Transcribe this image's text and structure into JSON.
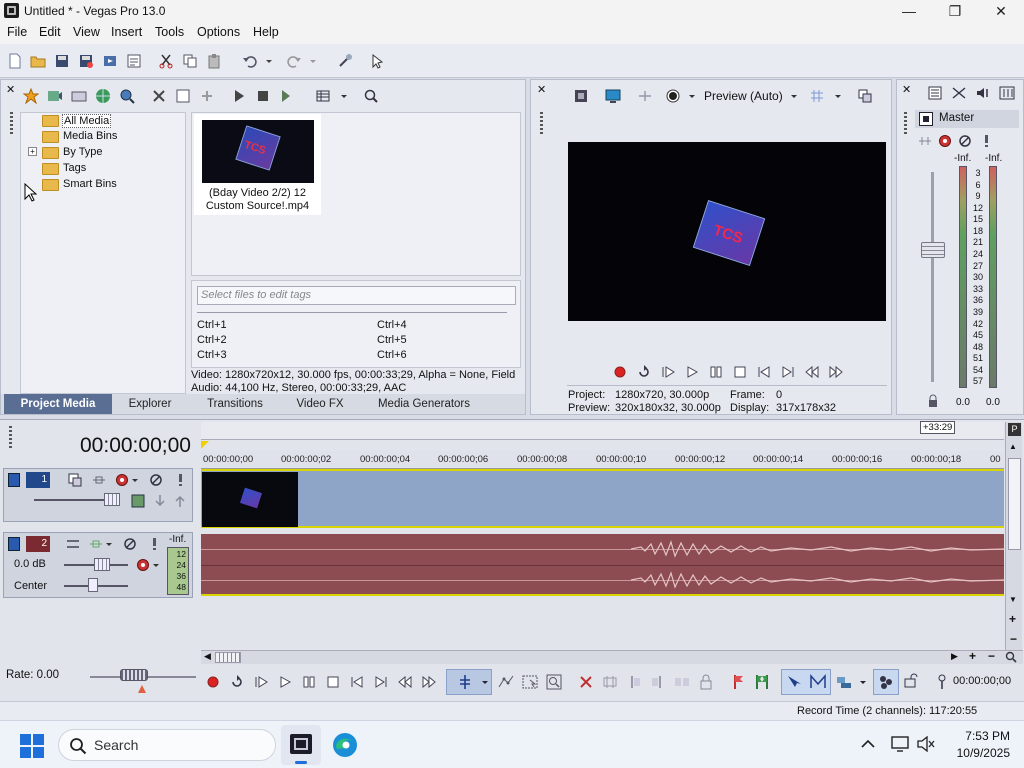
{
  "window": {
    "title": "Untitled * - Vegas Pro 13.0",
    "minimize": "—",
    "maximize": "❐",
    "close": "✕"
  },
  "menu": [
    "File",
    "Edit",
    "View",
    "Insert",
    "Tools",
    "Options",
    "Help"
  ],
  "explorer_tree": {
    "items": [
      {
        "label": "All Media",
        "selected": true
      },
      {
        "label": "Media Bins"
      },
      {
        "label": "By Type",
        "expander": "+"
      },
      {
        "label": "Tags"
      },
      {
        "label": "Smart Bins"
      }
    ]
  },
  "media": {
    "file_name": "(Bday Video 2/2) 12 Custom Source!.mp4",
    "file_name_line1": "(Bday Video 2/2) 12",
    "file_name_line2": "Custom Source!.mp4",
    "thumb_text": "TCS"
  },
  "tags": {
    "placeholder": "Select files to edit tags",
    "shortcuts": [
      "Ctrl+1",
      "Ctrl+4",
      "Ctrl+2",
      "Ctrl+5",
      "Ctrl+3",
      "Ctrl+6"
    ]
  },
  "media_info": {
    "video": "Video: 1280x720x12, 30.000 fps, 00:00:33;29, Alpha = None, Field",
    "audio": "Audio: 44,100 Hz, Stereo, 00:00:33;29, AAC"
  },
  "tabs": [
    "Project Media",
    "Explorer",
    "Transitions",
    "Video FX",
    "Media Generators"
  ],
  "active_tab": "Project Media",
  "preview": {
    "mode": "Preview (Auto)",
    "project_label": "Project:",
    "project_value": "1280x720, 30.000p",
    "preview_label": "Preview:",
    "preview_value": "320x180x32, 30.000p",
    "frame_label": "Frame:",
    "frame_value": "0",
    "display_label": "Display:",
    "display_value": "317x178x32"
  },
  "master": {
    "title": "Master",
    "left_label": "-Inf.",
    "right_label": "-Inf.",
    "scale": [
      "3",
      "6",
      "9",
      "12",
      "15",
      "18",
      "21",
      "24",
      "27",
      "30",
      "33",
      "36",
      "39",
      "42",
      "45",
      "48",
      "51",
      "54",
      "57"
    ],
    "left_value": "0.0",
    "right_value": "0.0"
  },
  "timeline": {
    "timecode": "00:00:00;00",
    "end_marker": "+33:29",
    "ruler": [
      "00:00:00;00",
      "00:00:00;02",
      "00:00:00;04",
      "00:00:00;06",
      "00:00:00;08",
      "00:00:00;10",
      "00:00:00;12",
      "00:00:00;14",
      "00:00:00;16",
      "00:00:00;18",
      "00"
    ],
    "video_track_number": "1",
    "audio_track_number": "2",
    "audio_volume": "0.0 dB",
    "audio_pan": "Center",
    "audio_inf": "-Inf.",
    "audio_meter_scale": [
      "12",
      "24",
      "36",
      "48"
    ],
    "rate": "Rate: 0.00",
    "transport_timecode": "00:00:00;00",
    "status": "Record Time (2 channels): 117:20:55"
  },
  "taskbar": {
    "search": "Search",
    "time": "7:53 PM",
    "date": "10/9/2025"
  },
  "colors": {
    "video_track": "#8ea5c7",
    "audio_track": "#8c4c52",
    "accent_blue": "#1e6fd9",
    "timeline_yellow": "#d8d400"
  }
}
